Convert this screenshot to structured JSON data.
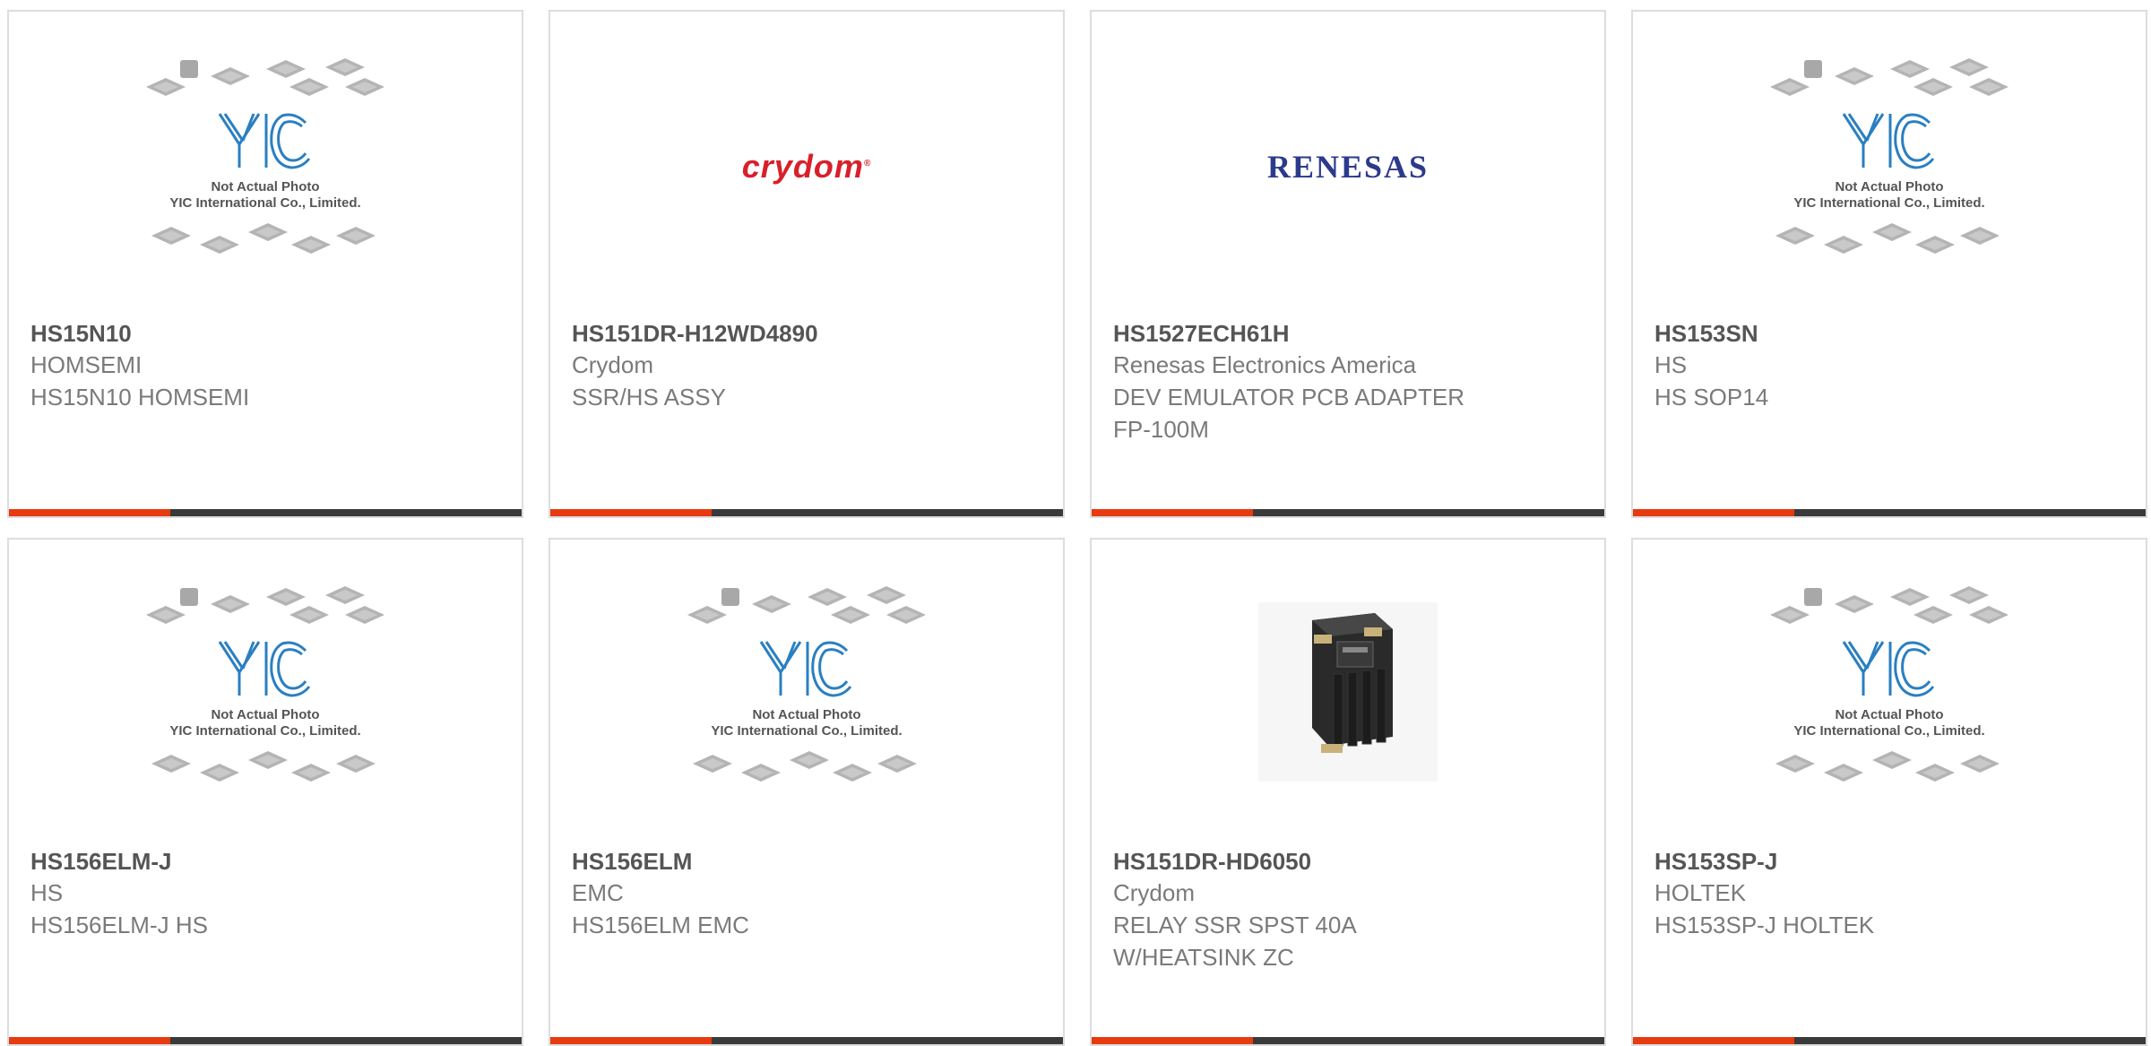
{
  "products": [
    {
      "image": "yic-placeholder",
      "part_number": "HS15N10",
      "manufacturer": "HOMSEMI",
      "description": "HS15N10 HOMSEMI"
    },
    {
      "image": "crydom-logo",
      "logo_text": "crydom",
      "logo_mark": "®",
      "part_number": "HS151DR-H12WD4890",
      "manufacturer": "Crydom",
      "description": "SSR/HS ASSY"
    },
    {
      "image": "renesas-logo",
      "logo_text": "RENESAS",
      "part_number": "HS1527ECH61H",
      "manufacturer": "Renesas Electronics America",
      "description": "DEV EMULATOR PCB ADAPTER FP-100M"
    },
    {
      "image": "yic-placeholder",
      "part_number": "HS153SN",
      "manufacturer": "HS",
      "description": "HS SOP14"
    },
    {
      "image": "yic-placeholder",
      "part_number": "HS156ELM-J",
      "manufacturer": "HS",
      "description": "HS156ELM-J HS"
    },
    {
      "image": "yic-placeholder",
      "part_number": "HS156ELM",
      "manufacturer": "EMC",
      "description": "HS156ELM EMC"
    },
    {
      "image": "relay-photo",
      "part_number": "HS151DR-HD6050",
      "manufacturer": "Crydom",
      "description": "RELAY SSR SPST 40A W/HEATSINK ZC"
    },
    {
      "image": "yic-placeholder",
      "part_number": "HS153SP-J",
      "manufacturer": "HOLTEK",
      "description": "HS153SP-J HOLTEK"
    }
  ],
  "placeholder": {
    "logo_text": "YIC",
    "line1": "Not Actual Photo",
    "line2": "YIC International Co., Limited."
  },
  "colors": {
    "accent": "#e83a10",
    "bar": "#3a3a3a",
    "placeholder_blue": "#2a7fc1",
    "crydom_red": "#d8202a",
    "renesas_blue": "#2c3a8c"
  }
}
